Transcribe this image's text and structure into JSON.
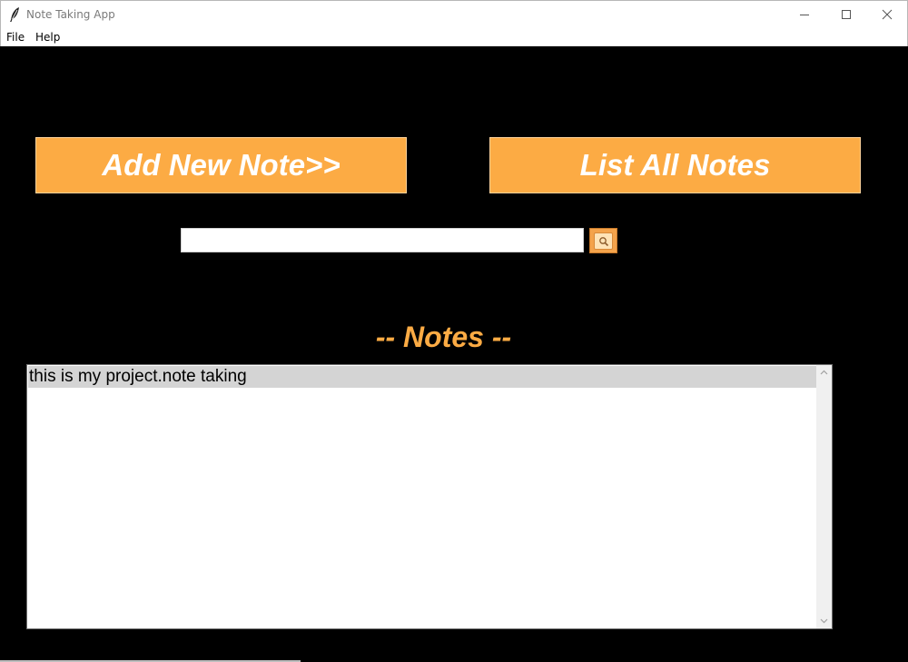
{
  "window": {
    "title": "Note Taking App",
    "app_icon": "feather-icon",
    "controls": [
      "minimize-icon",
      "maximize-icon",
      "close-icon"
    ]
  },
  "menu": {
    "file_label": "File",
    "help_label": "Help"
  },
  "main": {
    "add_note_label": "Add New Note>>",
    "list_notes_label": "List All Notes",
    "search": {
      "value": "",
      "placeholder": "",
      "button_icon": "search-icon"
    },
    "notes_heading": "-- Notes --",
    "notes": [
      "this is my project.note taking"
    ]
  },
  "colors": {
    "accent": "#fcab44",
    "background": "#000000",
    "selected_row": "#d4d4d4"
  }
}
